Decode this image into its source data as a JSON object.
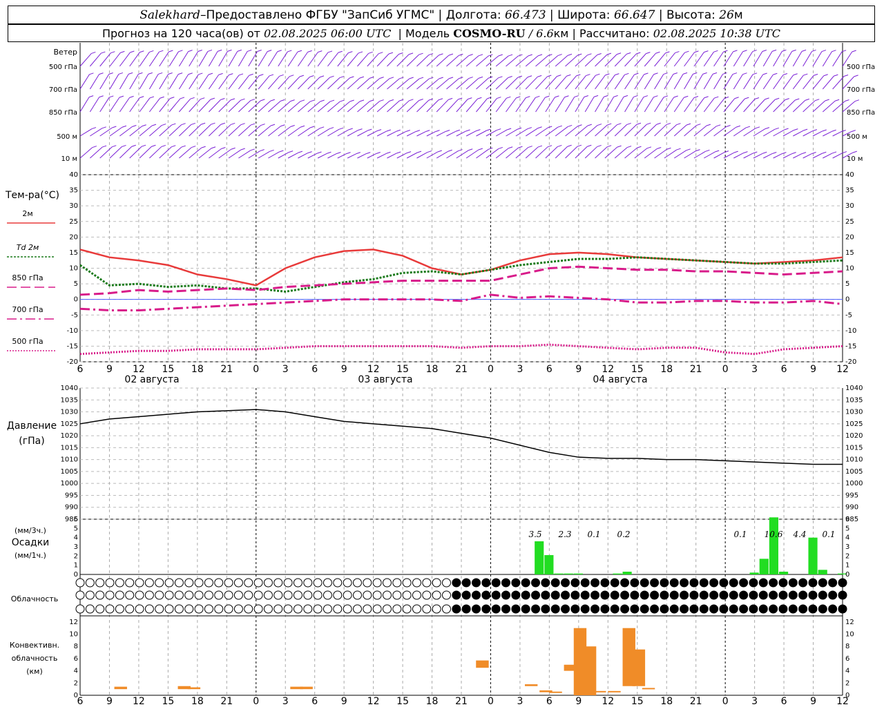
{
  "header": {
    "station": "Salekhard",
    "dash": " – ",
    "provider": "Предоставлено ФГБУ \"ЗапСиб УГМС\"",
    "lon_label": "Долгота:",
    "lon": "66.473",
    "lat_label": "Широта:",
    "lat": "66.647",
    "alt_label": "Высота:",
    "alt_value": "26",
    "alt_unit": "м",
    "forecast_prefix": "Прогноз на 120 часа(ов) от",
    "forecast_start": "02.08.2025 06:00 UTC",
    "model_label": "Модель",
    "model": "COSMO-RU",
    "model_res_sep": "/",
    "model_res": "6.6",
    "model_res_unit": "км",
    "computed_label": "Рассчитано:",
    "computed": "02.08.2025 10:38 UTC"
  },
  "wind": {
    "title": "Ветер",
    "levels": [
      "500 гПа",
      "700 гПа",
      "850 гПа",
      "500 м",
      "10 м"
    ],
    "color": "#7a1fd6"
  },
  "temperature": {
    "title": "Тем-ра(°С)",
    "legend": [
      {
        "label": "2м",
        "color": "#e83a3a",
        "style": "solid"
      },
      {
        "label": "Td  2м",
        "color": "#1a7a1a",
        "style": "dotted"
      },
      {
        "label": "850 гПа",
        "color": "#d81b8a",
        "style": "dashed"
      },
      {
        "label": "700 гПа",
        "color": "#d81b8a",
        "style": "dashdot"
      },
      {
        "label": "500 гПа",
        "color": "#d81b8a",
        "style": "fine-dot"
      }
    ]
  },
  "x_axis": {
    "ticks": [
      "6",
      "9",
      "12",
      "15",
      "18",
      "21",
      "0",
      "3",
      "6",
      "9",
      "12",
      "15",
      "18",
      "21",
      "0",
      "3",
      "6",
      "9",
      "12",
      "15",
      "18",
      "21",
      "0",
      "3",
      "6",
      "9",
      "12"
    ],
    "days": [
      "02 августа",
      "03 августа",
      "04 августа"
    ]
  },
  "pressure": {
    "title_line1": "Давление",
    "title_line2": "(гПа)"
  },
  "precip": {
    "title_line1": "(мм/3ч.)",
    "title_line2": "Осадки",
    "title_line3": "(мм/1ч.)",
    "totals": [
      "3.5",
      "2.3",
      "0.1",
      "0.2",
      "0.1",
      "10.6",
      "4.4",
      "0.1"
    ],
    "color": "#22dd22"
  },
  "cloud": {
    "title": "Облачность"
  },
  "convective": {
    "title_line1": "Конвективн.",
    "title_line2": "облачность",
    "title_line3": "(км)",
    "color": "#f08c28"
  },
  "chart_data": [
    {
      "type": "line",
      "title": "Тем-ра(°С)",
      "x": [
        6,
        9,
        12,
        15,
        18,
        21,
        0,
        3,
        6,
        9,
        12,
        15,
        18,
        21,
        0,
        3,
        6,
        9,
        12,
        15,
        18,
        21,
        0,
        3,
        6,
        9,
        12
      ],
      "ylim": [
        -20,
        40
      ],
      "series": [
        {
          "name": "2м",
          "values": [
            16,
            13.5,
            12.5,
            11,
            8,
            6.5,
            4.5,
            10,
            13.5,
            15.5,
            16,
            14,
            10,
            8,
            9.5,
            12.5,
            14.5,
            15,
            14.5,
            13.5,
            13,
            12.5,
            12,
            11.5,
            12,
            12.5,
            13.5
          ]
        },
        {
          "name": "Td  2м",
          "values": [
            11,
            4.5,
            5,
            4,
            4.5,
            3.5,
            3.5,
            2.5,
            4,
            5.5,
            6.5,
            8.5,
            9,
            8,
            9.5,
            11,
            12,
            13,
            13,
            13.5,
            13,
            12.5,
            12,
            11.5,
            11.5,
            12,
            12.5
          ]
        },
        {
          "name": "850 гПа",
          "values": [
            1.5,
            2,
            3,
            2.5,
            3,
            3.5,
            3,
            4,
            4.5,
            5,
            5.5,
            6,
            6,
            6,
            6,
            8,
            10,
            10.5,
            10,
            9.5,
            9.5,
            9,
            9,
            8.5,
            8,
            8.5,
            9
          ]
        },
        {
          "name": "700 гПа",
          "values": [
            -3,
            -3.5,
            -3.5,
            -3,
            -2.5,
            -2,
            -1.5,
            -1,
            -0.5,
            0,
            0,
            0,
            0,
            -0.5,
            1.5,
            0.5,
            1,
            0.5,
            0,
            -1,
            -1,
            -0.5,
            -0.5,
            -1,
            -1,
            -0.5,
            -1.5
          ]
        },
        {
          "name": "500 гПа",
          "values": [
            -17.5,
            -17,
            -16.5,
            -16.5,
            -16,
            -16,
            -16,
            -15.5,
            -15,
            -15,
            -15,
            -15,
            -15,
            -15.5,
            -15,
            -15,
            -14.5,
            -15,
            -15.5,
            -16,
            -15.5,
            -15.5,
            -17,
            -17.5,
            -16,
            -15.5,
            -15
          ]
        }
      ]
    },
    {
      "type": "line",
      "title": "Давление",
      "x": [
        6,
        9,
        12,
        15,
        18,
        21,
        0,
        3,
        6,
        9,
        12,
        15,
        18,
        21,
        0,
        3,
        6,
        9,
        12,
        15,
        18,
        21,
        0,
        3,
        6,
        9,
        12
      ],
      "ylim": [
        985,
        1040
      ],
      "series": [
        {
          "name": "",
          "values": [
            1025,
            1027,
            1028,
            1029,
            1030,
            1030.5,
            1031,
            1030,
            1028,
            1026,
            1025,
            1024,
            1023,
            1021,
            1019,
            1016,
            1013,
            1011,
            1010.5,
            1010.5,
            1010,
            1010,
            1009.5,
            1009,
            1008.5,
            1008,
            1008
          ]
        }
      ]
    },
    {
      "type": "bar",
      "title": "Осадки",
      "x": [
        3,
        4,
        5,
        6,
        7,
        8,
        9,
        10,
        11,
        12,
        13,
        14,
        15,
        3,
        4,
        5,
        6,
        7,
        8,
        9,
        10,
        11,
        12
      ],
      "ylim": [
        0,
        6
      ],
      "series": [
        {
          "name": "",
          "values": [
            0,
            0,
            3.6,
            2.1,
            0.1,
            0.1,
            0.1,
            0,
            0,
            0,
            0.1,
            0.3,
            0,
            0.2,
            1.7,
            6.2,
            0.3,
            0,
            0,
            4.0,
            0.5,
            0,
            0.1
          ]
        }
      ]
    },
    {
      "type": "bar",
      "title": "Конвективн. облачность (км)",
      "ylim": [
        0,
        13
      ],
      "x": [
        9.5,
        16,
        17,
        3.5,
        4.5,
        22.5,
        3.5,
        5,
        6,
        7.5,
        8.5,
        9.5,
        10.5,
        12,
        13.5,
        14.5,
        15.5
      ],
      "bottoms": [
        1,
        1,
        1,
        1,
        1,
        4.5,
        1.5,
        0.5,
        0.5,
        4,
        0,
        0,
        0.5,
        0.5,
        1.5,
        1.5,
        1
      ],
      "tops": [
        1.4,
        1.5,
        1.3,
        1.4,
        1.4,
        5.7,
        1.8,
        0.8,
        0.6,
        5,
        11,
        8,
        0.7,
        0.7,
        11,
        7.5,
        1.2
      ]
    }
  ]
}
